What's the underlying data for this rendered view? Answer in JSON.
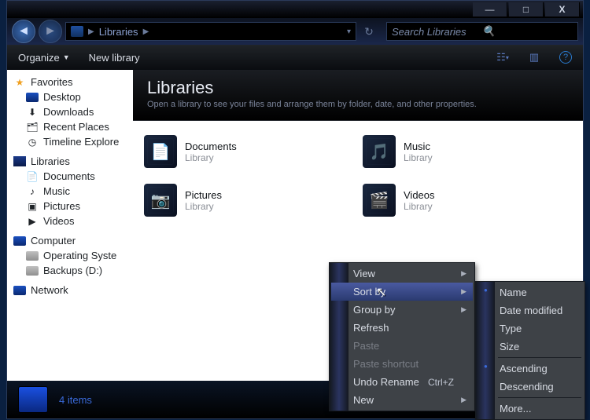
{
  "titlebar": {
    "min": "—",
    "max": "□",
    "close": "X"
  },
  "nav": {
    "breadcrumb": "Libraries",
    "search_placeholder": "Search Libraries"
  },
  "toolbar": {
    "organize": "Organize",
    "new_library": "New library"
  },
  "sidebar": {
    "favorites": {
      "label": "Favorites",
      "items": [
        {
          "label": "Desktop"
        },
        {
          "label": "Downloads"
        },
        {
          "label": "Recent Places"
        },
        {
          "label": "Timeline Explore"
        }
      ]
    },
    "libraries": {
      "label": "Libraries",
      "items": [
        {
          "label": "Documents"
        },
        {
          "label": "Music"
        },
        {
          "label": "Pictures"
        },
        {
          "label": "Videos"
        }
      ]
    },
    "computer": {
      "label": "Computer",
      "items": [
        {
          "label": "Operating Syste"
        },
        {
          "label": "Backups (D:)"
        }
      ]
    },
    "network": {
      "label": "Network"
    }
  },
  "content": {
    "title": "Libraries",
    "subtitle": "Open a library to see your files and arrange them by folder, date, and other properties.",
    "sub_label": "Library",
    "items": [
      {
        "name": "Documents",
        "glyph": "📄"
      },
      {
        "name": "Music",
        "glyph": "🎵"
      },
      {
        "name": "Pictures",
        "glyph": "📷"
      },
      {
        "name": "Videos",
        "glyph": "🎬"
      }
    ]
  },
  "status": {
    "text": "4 items"
  },
  "context_menu": {
    "items": [
      {
        "label": "View",
        "submenu": true
      },
      {
        "label": "Sort by",
        "submenu": true,
        "hover": true
      },
      {
        "label": "Group by",
        "submenu": true
      },
      {
        "label": "Refresh"
      },
      {
        "label": "Paste",
        "disabled": true
      },
      {
        "label": "Paste shortcut",
        "disabled": true
      },
      {
        "label": "Undo Rename",
        "shortcut": "Ctrl+Z"
      },
      {
        "label": "New",
        "submenu": true
      }
    ]
  },
  "sort_menu": {
    "items": [
      {
        "label": "Name",
        "checked": true
      },
      {
        "label": "Date modified"
      },
      {
        "label": "Type"
      },
      {
        "label": "Size"
      },
      {
        "label": "Ascending",
        "checked": true
      },
      {
        "label": "Descending"
      },
      {
        "label": "More..."
      }
    ]
  }
}
